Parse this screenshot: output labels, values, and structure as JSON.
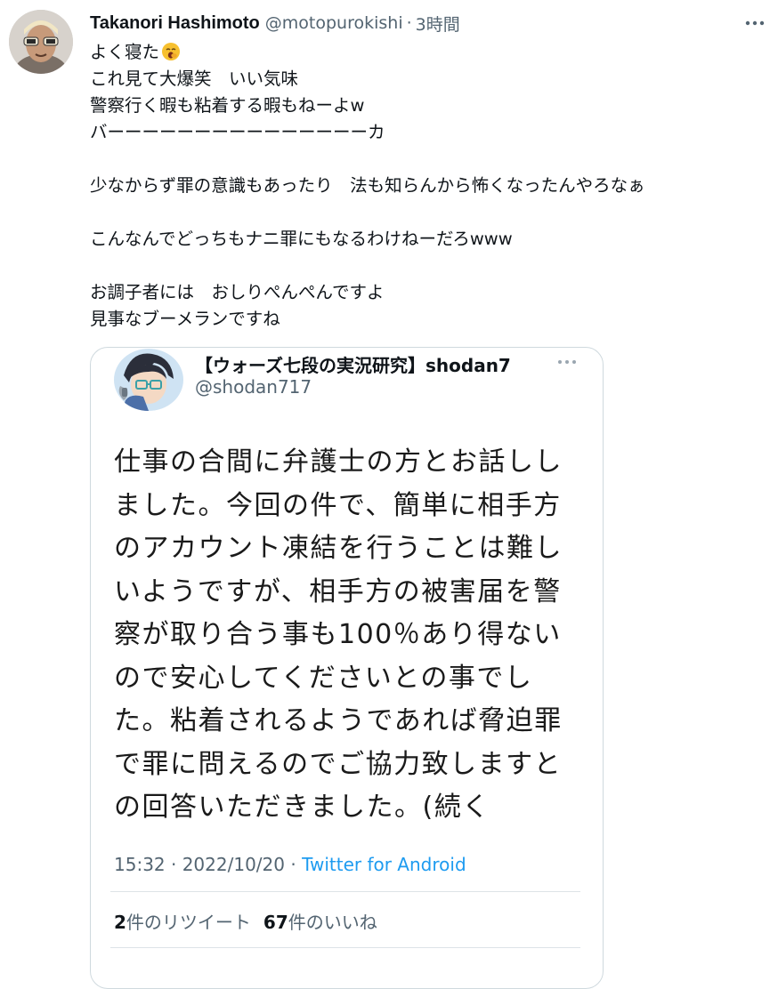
{
  "tweet": {
    "author_name": "Takanori Hashimoto",
    "author_handle": "@motopurokishi",
    "separator": "·",
    "time": "3時間",
    "more_icon": "more-horizontal-icon",
    "emoji": "yawning-face-emoji",
    "text_lines": [
      "よく寝た",
      "これ見て大爆笑　いい気味",
      "警察行く暇も粘着する暇もねーよw",
      "バーーーーーーーーーーーーーーーカ",
      "",
      "少なからず罪の意識もあったり　法も知らんから怖くなったんやろなぁ",
      "",
      "こんなんでどっちもナニ罪にもなるわけねーだろwww",
      "",
      "お調子者には　おしりぺんぺんですよ",
      "見事なブーメランですね"
    ]
  },
  "quoted": {
    "name": "【ウォーズ七段の実況研究】shodan7",
    "handle": "@shodan717",
    "more_icon": "more-horizontal-icon",
    "body_lines": [
      "仕事の合間に弁護士の方とお話しし",
      "ました。今回の件で、簡単に相手方",
      "のアカウント凍結を行うことは難し",
      "いようですが、相手方の被害届を警",
      "察が取り合う事も100％あり得ない",
      "ので安心してくださいとの事でし",
      "た。粘着されるようであれば脅迫罪",
      "で罪に問えるのでご協力致しますと",
      "の回答いただきました。(続く"
    ],
    "timestamp": "15:32 · 2022/10/20 · ",
    "client": "Twitter for Android",
    "retweet_count": "2",
    "retweet_label": "件のリツイート",
    "like_count": "67",
    "like_label": "件のいいね"
  },
  "colors": {
    "text_primary": "#0f1419",
    "text_secondary": "#536471",
    "link": "#1d9bf0",
    "border": "#cfd9de"
  }
}
